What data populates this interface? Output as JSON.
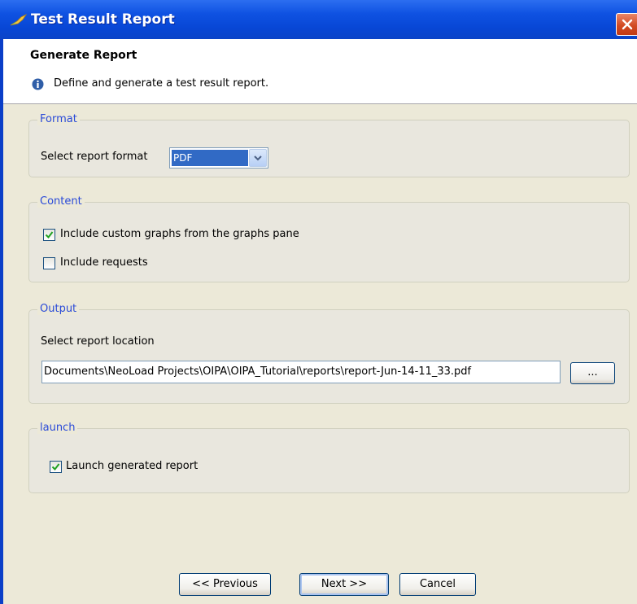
{
  "window": {
    "title": "Test Result Report"
  },
  "header": {
    "title": "Generate Report",
    "description": "Define and generate a test result report.",
    "info_icon": "info-icon"
  },
  "format": {
    "legend": "Format",
    "label": "Select report format",
    "selected": "PDF"
  },
  "content": {
    "legend": "Content",
    "include_graphs_label": "Include custom graphs from the graphs pane",
    "include_graphs_checked": true,
    "include_requests_label": "Include requests",
    "include_requests_checked": false
  },
  "output": {
    "legend": "Output",
    "location_label": "Select report location",
    "location_value": "Documents\\NeoLoad Projects\\OIPA\\OIPA_Tutorial\\reports\\report-Jun-14-11_33.pdf",
    "browse_label": "..."
  },
  "launch": {
    "legend": "launch",
    "launch_label": "Launch generated report",
    "launch_checked": true
  },
  "buttons": {
    "previous": "<< Previous",
    "next": "Next >>",
    "cancel": "Cancel"
  },
  "colors": {
    "titlebar": "#0a4ad8",
    "dialog_bg": "#ece9d8",
    "legend_text": "#2a4ad8",
    "selection": "#316ac5"
  }
}
